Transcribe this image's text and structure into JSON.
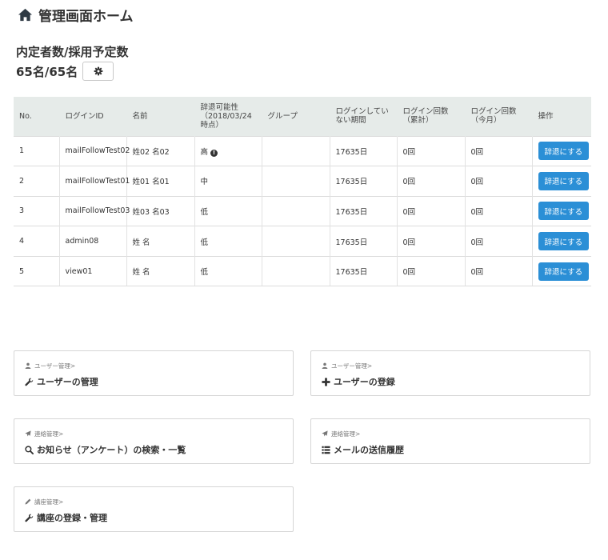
{
  "header": {
    "title": "管理画面ホーム",
    "icon": "home-icon"
  },
  "summary": {
    "label": "内定者数/採用予定数",
    "value": "65名/65名",
    "settings_icon": "gear-icon"
  },
  "table": {
    "headers": [
      "No.",
      "ログインID",
      "名前",
      "辞退可能性（2018/03/24時点）",
      "グループ",
      "ログインしていない期間",
      "ログイン回数（累計）",
      "ログイン回数（今月）",
      "操作"
    ],
    "rows": [
      {
        "no": "1",
        "login_id": "mailFollowTest02",
        "name": "姓02 名02",
        "risk": "高",
        "has_info": true,
        "group": "",
        "idle": "17635日",
        "total": "0回",
        "month": "0回",
        "action": "辞退にする"
      },
      {
        "no": "2",
        "login_id": "mailFollowTest01",
        "name": "姓01 名01",
        "risk": "中",
        "has_info": false,
        "group": "",
        "idle": "17635日",
        "total": "0回",
        "month": "0回",
        "action": "辞退にする"
      },
      {
        "no": "3",
        "login_id": "mailFollowTest03",
        "name": "姓03 名03",
        "risk": "低",
        "has_info": false,
        "group": "",
        "idle": "17635日",
        "total": "0回",
        "month": "0回",
        "action": "辞退にする"
      },
      {
        "no": "4",
        "login_id": "admin08",
        "name": "姓 名",
        "risk": "低",
        "has_info": false,
        "group": "",
        "idle": "17635日",
        "total": "0回",
        "month": "0回",
        "action": "辞退にする"
      },
      {
        "no": "5",
        "login_id": "view01",
        "name": "姓 名",
        "risk": "低",
        "has_info": false,
        "group": "",
        "idle": "17635日",
        "total": "0回",
        "month": "0回",
        "action": "辞退にする"
      }
    ]
  },
  "cards": [
    {
      "crumb": "ユーザー管理>",
      "crumb_icon": "user-icon",
      "title": "ユーザーの管理",
      "title_icon": "wrench-icon"
    },
    {
      "crumb": "ユーザー管理>",
      "crumb_icon": "user-icon",
      "title": "ユーザーの登録",
      "title_icon": "plus-icon"
    },
    {
      "crumb": "連絡管理>",
      "crumb_icon": "send-icon",
      "title": "お知らせ（アンケート）の検索・一覧",
      "title_icon": "search-icon"
    },
    {
      "crumb": "連絡管理>",
      "crumb_icon": "send-icon",
      "title": "メールの送信履歴",
      "title_icon": "list-icon"
    },
    {
      "crumb": "講座管理>",
      "crumb_icon": "pencil-icon",
      "title": "講座の登録・管理",
      "title_icon": "wrench-icon"
    }
  ]
}
